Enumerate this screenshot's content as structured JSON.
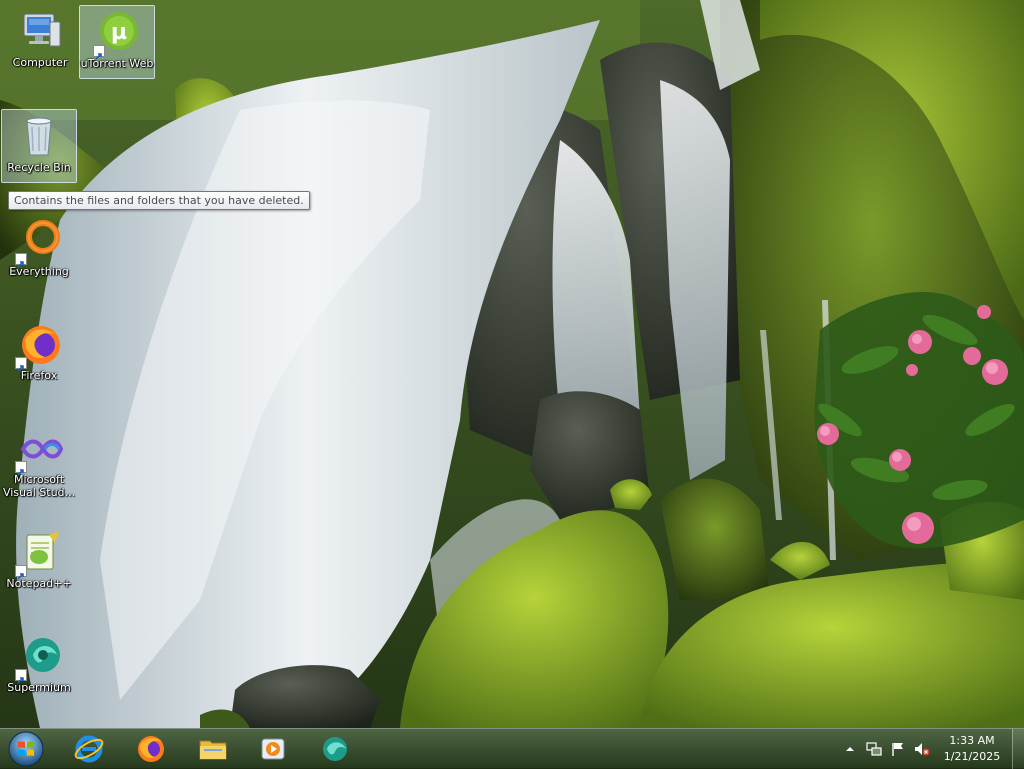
{
  "desktop": {
    "icons": [
      {
        "label": "Computer",
        "icon": "computer-icon",
        "shortcut": false
      },
      {
        "label": "uTorrent Web",
        "icon": "utorrent-icon",
        "shortcut": true
      },
      {
        "label": "Recycle Bin",
        "icon": "recycle-bin-icon",
        "shortcut": false
      },
      {
        "label": "Everything",
        "icon": "everything-search-icon",
        "shortcut": true
      },
      {
        "label": "Firefox",
        "icon": "firefox-icon",
        "shortcut": true
      },
      {
        "label": "Microsoft Visual Stud...",
        "icon": "visual-studio-icon",
        "shortcut": true
      },
      {
        "label": "Notepad++",
        "icon": "notepadpp-icon",
        "shortcut": true
      },
      {
        "label": "Supermium",
        "icon": "supermium-icon",
        "shortcut": true
      }
    ],
    "tooltip": "Contains the files and folders that you have deleted."
  },
  "taskbar": {
    "start": "start-orb-icon",
    "pinned": [
      {
        "icon": "internet-explorer-icon"
      },
      {
        "icon": "firefox-icon"
      },
      {
        "icon": "file-explorer-icon"
      },
      {
        "icon": "media-player-icon"
      },
      {
        "icon": "supermium-icon"
      }
    ],
    "tray_icons": [
      "show-hidden-icons-chevron-icon",
      "network-icon",
      "action-center-flag-icon",
      "volume-muted-icon"
    ]
  },
  "clock": {
    "time": "1:33 AM",
    "date": "1/21/2025"
  },
  "colors": {
    "selection": "#c8e1fa",
    "taskbar": "#2f4a22",
    "text": "#ffffff"
  }
}
